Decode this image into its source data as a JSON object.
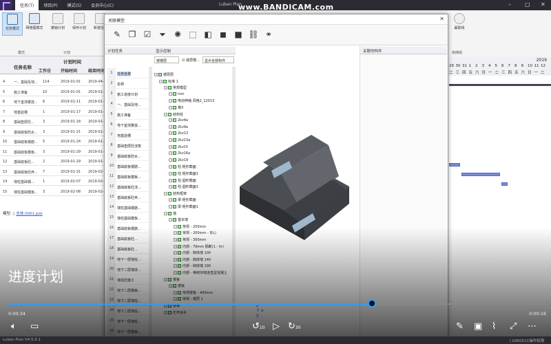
{
  "app": {
    "title": "Luban Plan",
    "watermark": "www.BANDICAM.com",
    "menus": [
      "任务(T)",
      "项目(P)",
      "模式(S)",
      "会员中心(C)"
    ],
    "window_controls": [
      "–",
      "▢",
      "✕"
    ]
  },
  "ribbon": {
    "buttons": [
      "任务模式",
      "网络图模式",
      "撤销计划",
      "保存计划",
      "新建任务"
    ],
    "groups": [
      "模式",
      "计划"
    ],
    "right_button": "赢取得",
    "right_group": "拖拽组"
  },
  "table": {
    "col_name": "任务名称",
    "col_group": "计划时间",
    "col_duration": "工作日",
    "col_start": "开始时间",
    "col_end": "结束时间",
    "rows": [
      {
        "n": "4",
        "name": "一、基础及地...",
        "dur": "114",
        "start": "2019-01-01",
        "end": "2019-04-..."
      },
      {
        "n": "5",
        "name": "施工准备",
        "dur": "10",
        "start": "2019-01-01",
        "end": "2019-01-..."
      },
      {
        "n": "6",
        "name": "地下室测量放...",
        "dur": "6",
        "start": "2019-01-11",
        "end": "2019-01-..."
      },
      {
        "n": "7",
        "name": "地基验槽",
        "dur": "1",
        "start": "2019-01-17",
        "end": "2019-01-..."
      },
      {
        "n": "8",
        "name": "基础垫层砼...",
        "dur": "3",
        "start": "2019-01-18",
        "end": "2019-01-..."
      },
      {
        "n": "9",
        "name": "基础底板防水...",
        "dur": "3",
        "start": "2019-01-21",
        "end": "2019-01-..."
      },
      {
        "n": "10",
        "name": "基础底板钢筋...",
        "dur": "5",
        "start": "2019-01-24",
        "end": "2019-01-..."
      },
      {
        "n": "11",
        "name": "基础底板模板...",
        "dur": "3",
        "start": "2019-01-29",
        "end": "2019-01-..."
      },
      {
        "n": "12",
        "name": "基础底板砼...",
        "dur": "2",
        "start": "2019-01-29",
        "end": "2019-01-..."
      },
      {
        "n": "13",
        "name": "基础底板砼养...",
        "dur": "7",
        "start": "2019-01-31",
        "end": "2019-02-..."
      },
      {
        "n": "14",
        "name": "墙柱基础钢...",
        "dur": "1",
        "start": "2019-02-07",
        "end": "2019-02-..."
      },
      {
        "n": "15",
        "name": "墙柱基础模板...",
        "dur": "3",
        "start": "2019-02-08",
        "end": "2019-02-..."
      }
    ],
    "footer_label": "模型:",
    "footer_link": "总体.0001.pds"
  },
  "gantt": {
    "year": "2019",
    "days": [
      "29",
      "30",
      "31",
      "1",
      "2",
      "3",
      "4",
      "5",
      "6",
      "7",
      "8",
      "9",
      "10",
      "11",
      "12"
    ],
    "weekdays": [
      "二",
      "三",
      "四",
      "五",
      "六",
      "日",
      "一",
      "二",
      "三",
      "四",
      "五",
      "六",
      "日",
      "一",
      "二"
    ]
  },
  "dialog": {
    "title": "关联模型",
    "close": "✕",
    "left_panel_title": "计划任务",
    "middle_panel_title": "显示控制",
    "right_panel_title": "关联的构件",
    "filter_select": "按楼层",
    "checkbox_label": "底层楼...",
    "show_all_select": "显示全部构件",
    "list": [
      {
        "n": "1",
        "t": "任务名称"
      },
      {
        "n": "2",
        "t": "名称"
      },
      {
        "n": "3",
        "t": "施工进度计划"
      },
      {
        "n": "4",
        "t": "一、基础及地..."
      },
      {
        "n": "5",
        "t": "施工准备"
      },
      {
        "n": "6",
        "t": "地下室测量放..."
      },
      {
        "n": "7",
        "t": "地基验槽"
      },
      {
        "n": "8",
        "t": "基础垫层砼浇筑"
      },
      {
        "n": "9",
        "t": "基础底板防水..."
      },
      {
        "n": "10",
        "t": "基础底板钢筋..."
      },
      {
        "n": "11",
        "t": "基础底板模板..."
      },
      {
        "n": "12",
        "t": "基础底板砼浇..."
      },
      {
        "n": "13",
        "t": "基础底板砼养..."
      },
      {
        "n": "14",
        "t": "墙柱基础钢筋..."
      },
      {
        "n": "15",
        "t": "墙柱基础模板..."
      },
      {
        "n": "16",
        "t": "基础底板钢筋..."
      },
      {
        "n": "17",
        "t": "基础底板砼..."
      },
      {
        "n": "18",
        "t": "基础底板砼..."
      },
      {
        "n": "19",
        "t": "地下一层墙柱..."
      },
      {
        "n": "20",
        "t": "地下二层墙体..."
      },
      {
        "n": "21",
        "t": "墙柱砼施工"
      },
      {
        "n": "22",
        "t": "地下二层模板..."
      },
      {
        "n": "23",
        "t": "地下二层墙柱..."
      },
      {
        "n": "24",
        "t": "地下二层墙柱..."
      },
      {
        "n": "25",
        "t": "地下一层墙柱..."
      },
      {
        "n": "26",
        "t": "地下一层模板..."
      }
    ],
    "tree": [
      {
        "lvl": 0,
        "t": "楼层层"
      },
      {
        "lvl": 1,
        "t": "标准 1"
      },
      {
        "lvl": 2,
        "t": "常规模型"
      },
      {
        "lvl": 3,
        "t": "iron"
      },
      {
        "lvl": 3,
        "t": "电动伸缩 风格2_12013"
      },
      {
        "lvl": 3,
        "t": "梯3"
      },
      {
        "lvl": 2,
        "t": "结构柱"
      },
      {
        "lvl": 3,
        "t": "2kz4a"
      },
      {
        "lvl": 3,
        "t": "2kz9a"
      },
      {
        "lvl": 3,
        "t": "2kz13"
      },
      {
        "lvl": 3,
        "t": "2kz13a"
      },
      {
        "lvl": 3,
        "t": "2kz15"
      },
      {
        "lvl": 3,
        "t": "2kz16a"
      },
      {
        "lvl": 3,
        "t": "2kz19"
      },
      {
        "lvl": 3,
        "t": "柱-矩形截面"
      },
      {
        "lvl": 3,
        "t": "柱-矩形截面1"
      },
      {
        "lvl": 3,
        "t": "柱-圆形截面"
      },
      {
        "lvl": 3,
        "t": "柱-圆形截面1"
      },
      {
        "lvl": 2,
        "t": "结构框架"
      },
      {
        "lvl": 3,
        "t": "梁-矩形截面"
      },
      {
        "lvl": 3,
        "t": "梁-矩形截面1"
      },
      {
        "lvl": 2,
        "t": "墙"
      },
      {
        "lvl": 3,
        "t": "基本墙"
      },
      {
        "lvl": 4,
        "t": "常规 - 200mm"
      },
      {
        "lvl": 4,
        "t": "常规 - 200mm - 实心"
      },
      {
        "lvl": 4,
        "t": "常规 - 300mm"
      },
      {
        "lvl": 4,
        "t": "内部 - 79mm 隔断(1 - hr)"
      },
      {
        "lvl": 4,
        "t": "内部 - 砌体墙 100"
      },
      {
        "lvl": 4,
        "t": "内部 - 砌体墙 140"
      },
      {
        "lvl": 4,
        "t": "内部 - 砌体墙 190"
      },
      {
        "lvl": 4,
        "t": "内部 - 等砌块墙连直型混凝土"
      },
      {
        "lvl": 2,
        "t": "楼板"
      },
      {
        "lvl": 3,
        "t": "楼板"
      },
      {
        "lvl": 4,
        "t": "常规楼板 - 400mm"
      },
      {
        "lvl": 4,
        "t": "常规 - 楼层 1"
      },
      {
        "lvl": 2,
        "t": "楼梯"
      },
      {
        "lvl": 2,
        "t": "栏杆扶手"
      }
    ],
    "toolbar_icons": [
      "edit-icon",
      "copy-icon",
      "list-check-icon",
      "filter-icon",
      "loading-icon",
      "select-box-icon",
      "cube-icon",
      "cube-solid-icon",
      "cube-dark-icon",
      "link-icon",
      "unlink-icon"
    ]
  },
  "video": {
    "subtitle": "进度计划",
    "current_time": "0:00:34",
    "total_time": "0:00:16",
    "progress": 0.68,
    "skip_back": "10",
    "skip_fwd": "30"
  },
  "statusbar": {
    "left": "Luban Plan V4.5.0.1",
    "right": "| GWQ511操作权限"
  }
}
